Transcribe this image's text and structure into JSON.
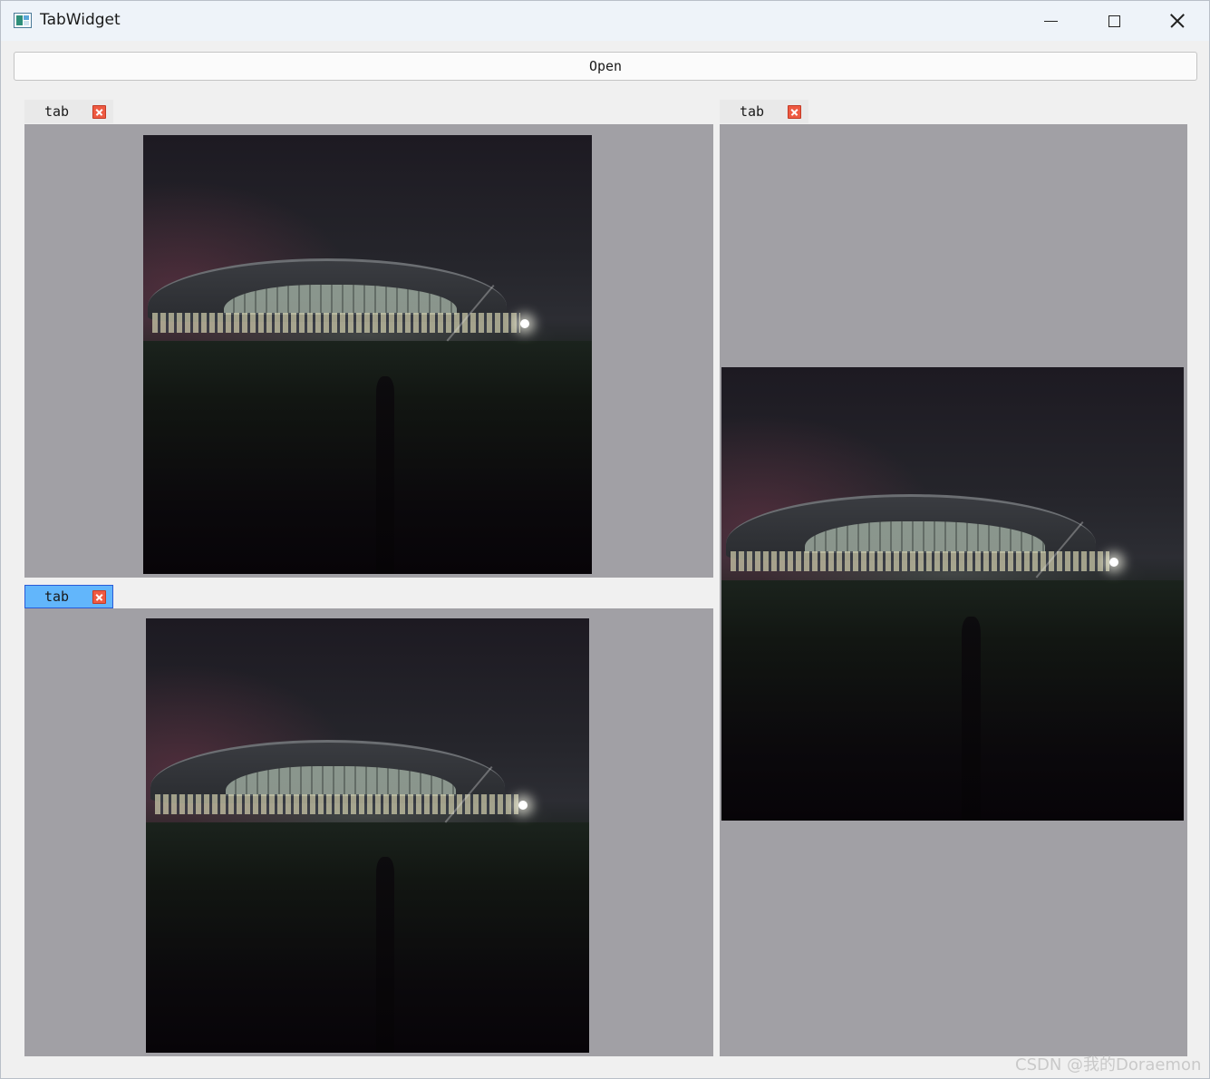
{
  "window": {
    "title": "TabWidget",
    "controls": {
      "minimize": "minimize-icon",
      "maximize": "maximize-icon",
      "close": "close-icon"
    }
  },
  "toolbar": {
    "open_label": "Open"
  },
  "tab_widgets": [
    {
      "tabs": [
        {
          "label": "tab",
          "active": false,
          "close_icon": "close-icon"
        }
      ]
    },
    {
      "tabs": [
        {
          "label": "tab",
          "active": true,
          "close_icon": "close-icon"
        }
      ]
    },
    {
      "tabs": [
        {
          "label": "tab",
          "active": false,
          "close_icon": "close-icon"
        }
      ]
    }
  ],
  "colors": {
    "active_tab": "#62b6fb",
    "active_tab_border": "#2a5bd7",
    "tab_close": "#ee5a42",
    "pane_background": "#a1a0a5"
  },
  "watermark": "CSDN @我的Doraemon"
}
